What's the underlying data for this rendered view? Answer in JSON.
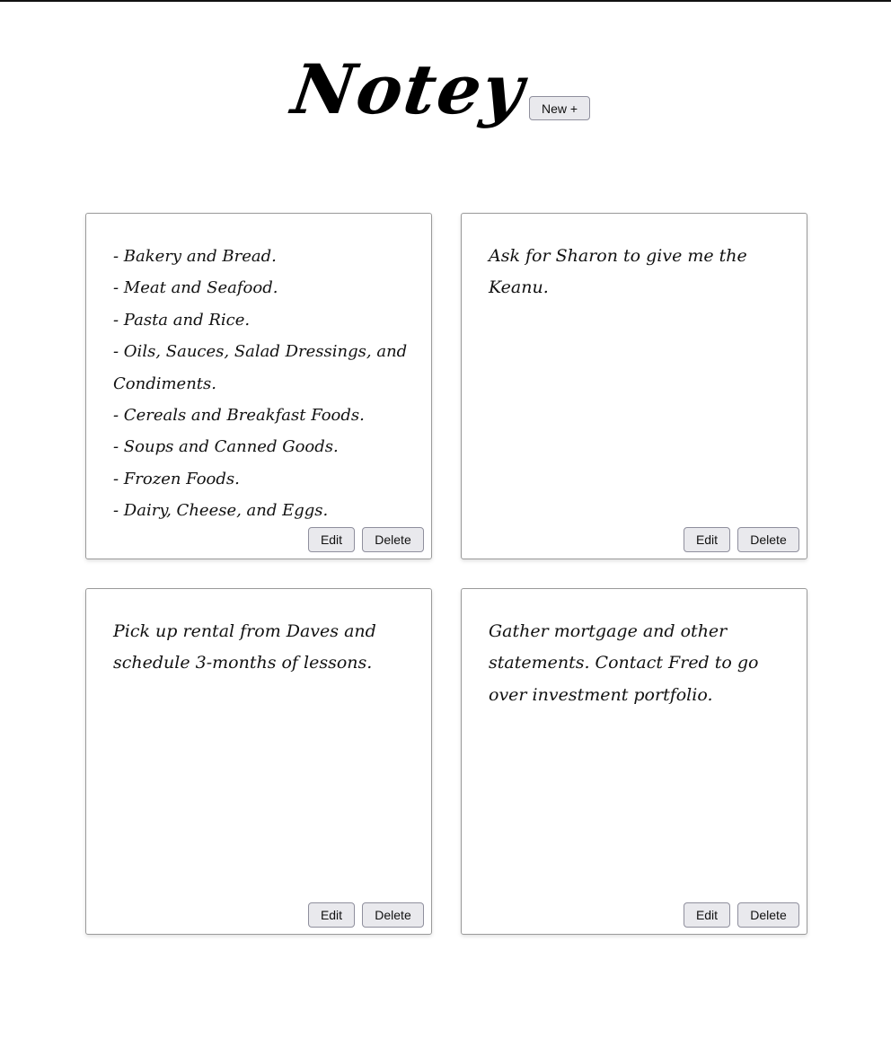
{
  "app": {
    "logo_text": "Notey",
    "new_button_label": "New +"
  },
  "notes": [
    {
      "text": "- Bakery and Bread.\n- Meat and Seafood.\n- Pasta and Rice.\n- Oils, Sauces, Salad Dressings, and Condiments.\n- Cereals and Breakfast Foods.\n- Soups and Canned Goods.\n- Frozen Foods.\n- Dairy, Cheese, and Eggs.",
      "edit_label": "Edit",
      "delete_label": "Delete"
    },
    {
      "text": "Ask for Sharon to give me the Keanu.",
      "edit_label": "Edit",
      "delete_label": "Delete"
    },
    {
      "text": "Pick up rental from Daves and schedule 3-months of lessons.",
      "edit_label": "Edit",
      "delete_label": "Delete"
    },
    {
      "text": "Gather mortgage and other statements. Contact Fred to go over investment portfolio.",
      "edit_label": "Edit",
      "delete_label": "Delete"
    }
  ],
  "colors": {
    "background": "#ffffff",
    "text": "#111111",
    "button_bg": "#e9e9ed",
    "button_border": "#8f8f9d",
    "card_border": "#9a9a9a"
  }
}
